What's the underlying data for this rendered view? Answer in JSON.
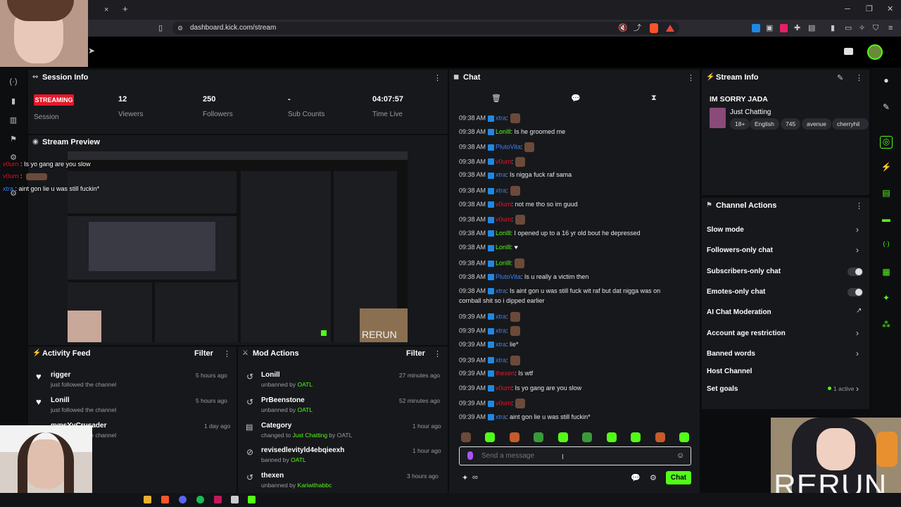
{
  "browser": {
    "url": "dashboard.kick.com/stream",
    "new_tab": "+",
    "close_tab": "×"
  },
  "session": {
    "title": "Session Info",
    "status": "STREAMING",
    "status_label": "Session",
    "stats": [
      {
        "value": "12",
        "label": "Viewers"
      },
      {
        "value": "250",
        "label": "Followers"
      },
      {
        "value": "-",
        "label": "Sub Counts"
      },
      {
        "value": "04:07:57",
        "label": "Time Live"
      }
    ]
  },
  "preview": {
    "title": "Stream Preview",
    "overlay_lines": [
      {
        "user": "v0urn",
        "text": " : Is yo gang are you slow"
      },
      {
        "user": "v0urn",
        "text": " :"
      },
      {
        "user": "xtra",
        "text": " : aint gon lie u was still fuckin*"
      }
    ],
    "rerun_label": "RERUN"
  },
  "activity": {
    "title": "Activity Feed",
    "filter": "Filter",
    "items": [
      {
        "name": "rigger",
        "sub": "just followed the channel",
        "time": "5 hours ago"
      },
      {
        "name": "Lonill",
        "sub": "just followed the channel",
        "time": "5 hours ago"
      },
      {
        "name": "gypsYyCrusader",
        "sub": "just followed the channel",
        "time": "1 day ago"
      }
    ]
  },
  "mod": {
    "title": "Mod Actions",
    "filter": "Filter",
    "items": [
      {
        "name": "Lonill",
        "sub_pre": "unbanned by ",
        "sub_user": "OATL",
        "sub_post": "",
        "time": "27 minutes ago"
      },
      {
        "name": "PrBeenstone",
        "sub_pre": "unbanned by ",
        "sub_user": "OATL",
        "sub_post": "",
        "time": "52 minutes ago"
      },
      {
        "name": "Category",
        "sub_pre": "changed to ",
        "sub_user": "Just Chatting",
        "sub_post": " by OATL",
        "time": "1 hour ago"
      },
      {
        "name": "revisedlevityld4ebqieexh",
        "sub_pre": "banned by ",
        "sub_user": "OATL",
        "sub_post": "",
        "time": "1 hour ago"
      },
      {
        "name": "thexen",
        "sub_pre": "unbanned by ",
        "sub_user": "Kariwithabbc",
        "sub_post": "",
        "time": "3 hours ago"
      }
    ]
  },
  "chat": {
    "title": "Chat",
    "messages": [
      {
        "time": "09:38 AM",
        "user": "xtra",
        "color": "#3b82f6",
        "text": ":",
        "emote": true
      },
      {
        "time": "09:38 AM",
        "user": "LonIll",
        "color": "#53fc18",
        "text": ": Is he groomed me",
        "emote": false
      },
      {
        "time": "09:38 AM",
        "user": "PlutoVita",
        "color": "#3b82f6",
        "text": ":",
        "emote": true
      },
      {
        "time": "09:38 AM",
        "user": "v0urn",
        "color": "#e5182a",
        "text": ":",
        "emote": true
      },
      {
        "time": "09:38 AM",
        "user": "xtra",
        "color": "#3b82f6",
        "text": ": Is nigga fuck raf sama",
        "emote": false
      },
      {
        "time": "09:38 AM",
        "user": "xtra",
        "color": "#3b82f6",
        "text": ":",
        "emote": true
      },
      {
        "time": "09:38 AM",
        "user": "v0urn",
        "color": "#e5182a",
        "text": ": not me tho so im guud",
        "emote": false
      },
      {
        "time": "09:38 AM",
        "user": "v0urn",
        "color": "#e5182a",
        "text": ":",
        "emote": true
      },
      {
        "time": "09:38 AM",
        "user": "LonIll",
        "color": "#53fc18",
        "text": ": I opened up to a 16 yr old bout he depressed",
        "emote": false
      },
      {
        "time": "09:38 AM",
        "user": "LonIll",
        "color": "#53fc18",
        "text": ": ♥",
        "emote": false
      },
      {
        "time": "09:38 AM",
        "user": "LonIll",
        "color": "#53fc18",
        "text": ":",
        "emote": true
      },
      {
        "time": "09:38 AM",
        "user": "PlutoVita",
        "color": "#3b82f6",
        "text": ": Is u really a victim then",
        "emote": false
      },
      {
        "time": "09:38 AM",
        "user": "xtra",
        "color": "#3b82f6",
        "text": ": Is aint gon u was still fuck wit raf but dat nigga was on",
        "emote": false
      },
      {
        "time": "",
        "user": "",
        "color": "#e8e8e8",
        "text": "cornball shit so i dipped earlier",
        "emote": false
      },
      {
        "time": "09:39 AM",
        "user": "xtra",
        "color": "#3b82f6",
        "text": ":",
        "emote": true
      },
      {
        "time": "09:39 AM",
        "user": "xtra",
        "color": "#3b82f6",
        "text": ":",
        "emote": true
      },
      {
        "time": "09:39 AM",
        "user": "xtra",
        "color": "#3b82f6",
        "text": ": lie*",
        "emote": false
      },
      {
        "time": "09:39 AM",
        "user": "xtra",
        "color": "#3b82f6",
        "text": ":",
        "emote": true
      },
      {
        "time": "09:39 AM",
        "user": "thexen",
        "color": "#e5182a",
        "text": ": Is wtf",
        "emote": false
      },
      {
        "time": "09:39 AM",
        "user": "v0urn",
        "color": "#e5182a",
        "text": ": Is yo gang are you slow",
        "emote": false
      },
      {
        "time": "09:39 AM",
        "user": "v0urn",
        "color": "#e5182a",
        "text": ":",
        "emote": true
      },
      {
        "time": "09:39 AM",
        "user": "xtra",
        "color": "#3b82f6",
        "text": ": aint gon lie u was still fuckin*",
        "emote": false
      }
    ],
    "input_placeholder": "Send a message",
    "send_label": "Chat"
  },
  "stream_info": {
    "title": "Stream Info",
    "stream_title": "IM SORRY JADA",
    "category": "Just Chatting",
    "tags": [
      "18+",
      "English",
      "745",
      "avenue",
      "cherryhil"
    ]
  },
  "channel_actions": {
    "title": "Channel Actions",
    "items": [
      {
        "label": "Slow mode",
        "control": "chevron"
      },
      {
        "label": "Followers-only chat",
        "control": "chevron"
      },
      {
        "label": "Subscribers-only chat",
        "control": "toggle"
      },
      {
        "label": "Emotes-only chat",
        "control": "toggle"
      },
      {
        "label": "AI Chat Moderation",
        "control": "external"
      },
      {
        "label": "Account age restriction",
        "control": "chevron"
      },
      {
        "label": "Banned words",
        "control": "chevron"
      },
      {
        "label": "Host Channel",
        "control": "none"
      },
      {
        "label": "Set goals",
        "control": "chevron",
        "extra": "1 active"
      }
    ]
  },
  "cam": {
    "rerun_label": "RERUN"
  },
  "colors": {
    "accent": "#53fc18",
    "live": "#e5182a",
    "panel": "#17181b",
    "background": "#0b0c0e"
  }
}
